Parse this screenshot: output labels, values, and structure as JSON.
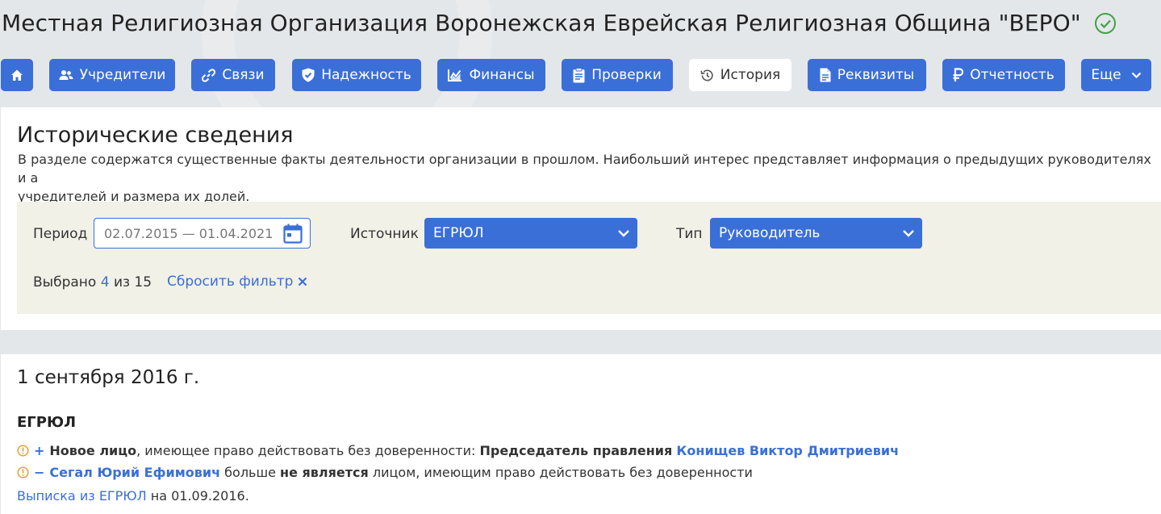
{
  "organization": {
    "title": "Местная Религиозная Организация Воронежская Еврейская Религиозная Община \"ВЕРО\"",
    "status_icon": "check-circle-icon",
    "status_color": "#43a047"
  },
  "nav": {
    "home_icon": "home-icon",
    "items": [
      {
        "label": "Учредители",
        "icon": "people-icon"
      },
      {
        "label": "Связи",
        "icon": "link-icon"
      },
      {
        "label": "Надежность",
        "icon": "shield-check-icon"
      },
      {
        "label": "Финансы",
        "icon": "chart-icon"
      },
      {
        "label": "Проверки",
        "icon": "clipboard-icon"
      },
      {
        "label": "История",
        "icon": "history-icon",
        "active": true
      },
      {
        "label": "Реквизиты",
        "icon": "document-icon"
      },
      {
        "label": "Отчетность",
        "icon": "ruble-icon"
      },
      {
        "label": "Еще",
        "icon": "chevron-down-icon"
      }
    ],
    "accent_color": "#3a6fd8"
  },
  "history": {
    "title": "Исторические сведения",
    "description": "В разделе содержатся существенные факты деятельности организации в прошлом. Наибольший интерес представляет информация о предыдущих руководителях и а\nучредителей и размера их долей.",
    "filter": {
      "period_label": "Период",
      "period_value": "02.07.2015 — 01.04.2021",
      "source_label": "Источник",
      "source_value": "ЕГРЮЛ",
      "type_label": "Тип",
      "type_value": "Руководитель",
      "selected_prefix": "Выбрано",
      "selected_count": "4",
      "selected_of": "из 15",
      "reset_label": "Сбросить фильтр"
    }
  },
  "events": {
    "date": "1 сентября 2016 г.",
    "source": "ЕГРЮЛ",
    "items": [
      {
        "sign": "+",
        "bold_start": "Новое лицо",
        "text": ", имеющее право действовать без доверенности: ",
        "role": "Председатель правления",
        "person": "Конищев Виктор Дмитриевич"
      },
      {
        "sign": "−",
        "person": "Сегал Юрий Ефимович",
        "text1": " больше ",
        "bold": "не является",
        "text2": " лицом, имеющим право действовать без доверенности"
      }
    ],
    "extract_link": "Выписка из ЕГРЮЛ",
    "extract_suffix": " на 01.09.2016."
  }
}
